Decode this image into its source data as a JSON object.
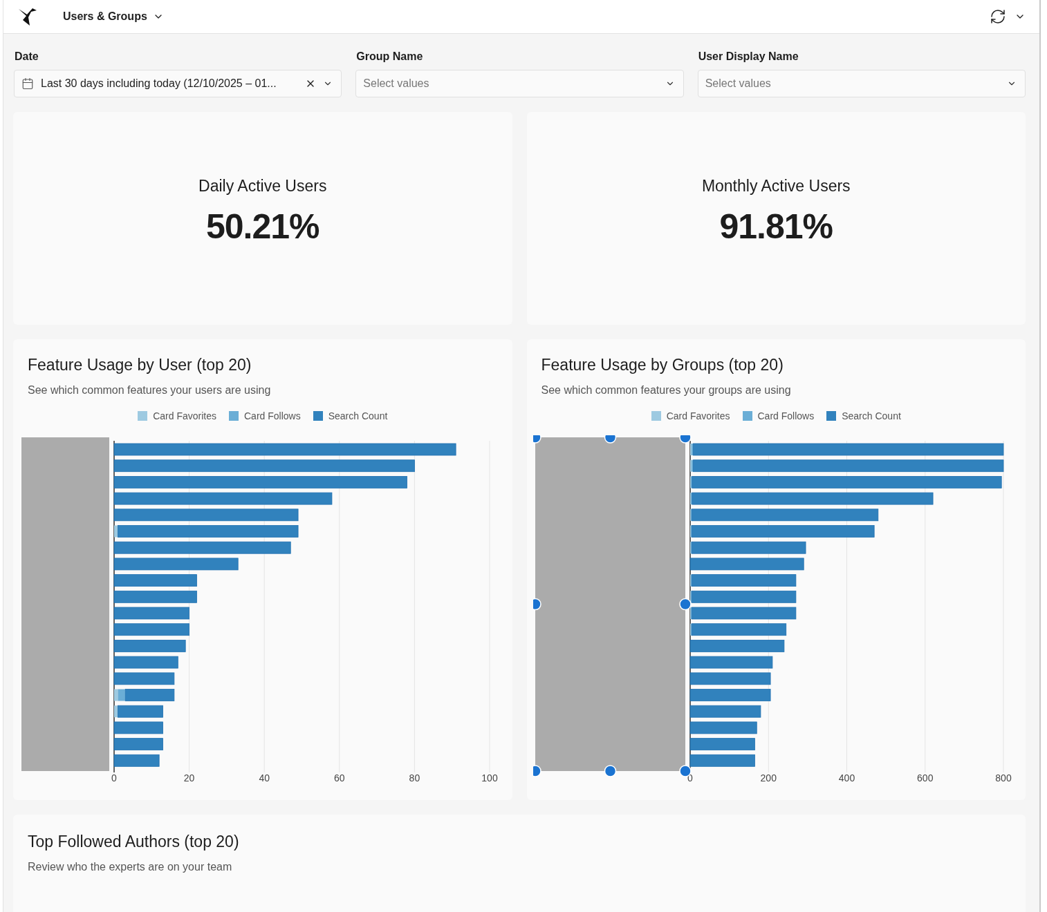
{
  "header": {
    "title": "Users & Groups"
  },
  "filters": [
    {
      "label": "Date",
      "kind": "date",
      "value": "Last 30 days including today (12/10/2025 – 01...",
      "clearable": true
    },
    {
      "label": "Group Name",
      "kind": "select",
      "placeholder": "Select values"
    },
    {
      "label": "User Display Name",
      "kind": "select",
      "placeholder": "Select values"
    }
  ],
  "kpis": [
    {
      "title": "Daily Active Users",
      "value": "50.21%"
    },
    {
      "title": "Monthly Active Users",
      "value": "91.81%"
    }
  ],
  "charts": [
    {
      "title": "Feature Usage by User (top 20)",
      "subtitle": "See which common features your users are using",
      "redaction_selected": false,
      "chart_data": {
        "type": "bar",
        "orientation": "horizontal",
        "stacked": true,
        "grid": true,
        "xlim": [
          0,
          100
        ],
        "xticks": [
          0,
          20,
          40,
          60,
          80,
          100
        ],
        "series": [
          {
            "name": "Card Favorites",
            "color": "#9ecae1",
            "values": [
              0,
              0,
              0,
              0,
              0,
              1,
              0,
              0,
              0,
              0,
              0,
              0,
              0,
              0,
              0,
              1,
              1,
              0,
              0,
              0
            ]
          },
          {
            "name": "Card Follows",
            "color": "#6baed6",
            "values": [
              0,
              0,
              0,
              0,
              0,
              0,
              0,
              0,
              0,
              0,
              0,
              0,
              0,
              0,
              0,
              2,
              0,
              0,
              0,
              0
            ]
          },
          {
            "name": "Search Count",
            "color": "#3182bd",
            "values": [
              91,
              80,
              78,
              58,
              49,
              48,
              47,
              33,
              22,
              22,
              20,
              20,
              19,
              17,
              16,
              13,
              12,
              13,
              13,
              12
            ]
          }
        ]
      }
    },
    {
      "title": "Feature Usage by Groups (top 20)",
      "subtitle": "See which common features your groups are using",
      "redaction_selected": true,
      "chart_data": {
        "type": "bar",
        "orientation": "horizontal",
        "stacked": true,
        "grid": true,
        "xlim": [
          0,
          800
        ],
        "xticks": [
          0,
          200,
          400,
          600,
          800
        ],
        "series": [
          {
            "name": "Card Favorites",
            "color": "#9ecae1",
            "values": [
              3,
              3,
              2,
              2,
              2,
              2,
              2,
              0,
              2,
              2,
              2,
              2,
              0,
              0,
              0,
              0,
              0,
              0,
              0,
              0
            ]
          },
          {
            "name": "Card Follows",
            "color": "#6baed6",
            "values": [
              5,
              5,
              3,
              3,
              2,
              2,
              2,
              0,
              2,
              2,
              2,
              2,
              0,
              0,
              0,
              0,
              0,
              0,
              0,
              0
            ]
          },
          {
            "name": "Search Count",
            "color": "#3182bd",
            "values": [
              792,
              792,
              790,
              615,
              476,
              466,
              291,
              290,
              266,
              266,
              266,
              241,
              240,
              210,
              205,
              205,
              180,
              170,
              165,
              165
            ]
          }
        ]
      }
    }
  ],
  "bottom": {
    "title": "Top Followed Authors (top 20)",
    "subtitle": "Review who the experts are on your team"
  }
}
